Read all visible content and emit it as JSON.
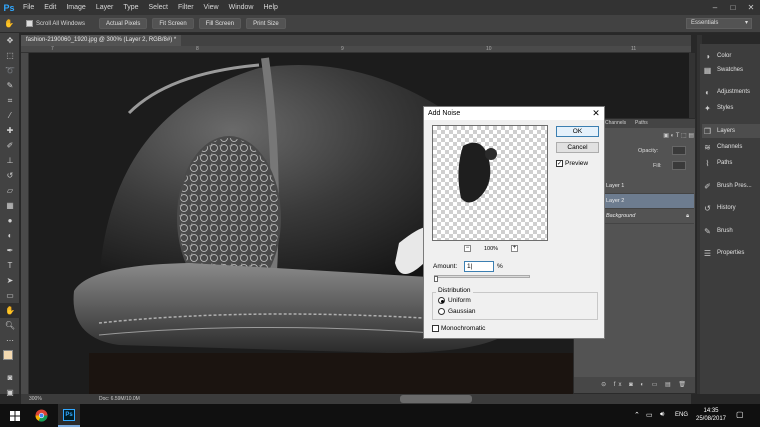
{
  "app": {
    "logo": "Ps",
    "menu": [
      "File",
      "Edit",
      "Image",
      "Layer",
      "Type",
      "Select",
      "Filter",
      "View",
      "Window",
      "Help"
    ],
    "window_controls": [
      "–",
      "□",
      "✕"
    ]
  },
  "options_bar": {
    "scroll_all_windows": "Scroll All Windows",
    "actual_pixels": "Actual Pixels",
    "fit_screen": "Fit Screen",
    "fill_screen": "Fill Screen",
    "print_size": "Print Size",
    "workspace": "Essentials"
  },
  "document": {
    "tab_title": "fashion-2190060_1920.jpg @ 300% (Layer 2, RGB/8#) *",
    "status_zoom": "300%",
    "status_doc": "Doc: 6.59M/10.0M"
  },
  "ruler": {
    "top_ticks": [
      "7",
      "8",
      "9",
      "10",
      "11"
    ]
  },
  "right_panel": {
    "items": [
      {
        "label": "Color",
        "icon": "color-icon"
      },
      {
        "label": "Swatches",
        "icon": "swatches-icon"
      },
      {
        "label": "Adjustments",
        "icon": "adjustments-icon"
      },
      {
        "label": "Styles",
        "icon": "styles-icon"
      },
      {
        "label": "Layers",
        "icon": "layers-icon"
      },
      {
        "label": "Channels",
        "icon": "channels-icon"
      },
      {
        "label": "Paths",
        "icon": "paths-icon"
      },
      {
        "label": "Brush Pres...",
        "icon": "brush-presets-icon"
      },
      {
        "label": "History",
        "icon": "history-icon"
      },
      {
        "label": "Brush",
        "icon": "brush-icon"
      },
      {
        "label": "Properties",
        "icon": "properties-icon"
      }
    ]
  },
  "layers_panel": {
    "tabs": [
      "Channels",
      "Paths"
    ],
    "opacity_label": "Opacity:",
    "fill_label": "Fill:",
    "layers": [
      "Layer 1",
      "Layer 2",
      "Background"
    ]
  },
  "dialog": {
    "title": "Add Noise",
    "ok": "OK",
    "cancel": "Cancel",
    "preview_label": "Preview",
    "preview_checked": true,
    "zoom": "100%",
    "zoom_out": "−",
    "zoom_in": "+",
    "amount_label": "Amount:",
    "amount_value": "1",
    "amount_unit": "%",
    "amount_slider_fraction": 0.01,
    "distribution_label": "Distribution",
    "uniform_label": "Uniform",
    "gaussian_label": "Gaussian",
    "selected_distribution": "Uniform",
    "monochromatic_label": "Monochromatic",
    "monochromatic_checked": false
  },
  "taskbar": {
    "language": "ENG",
    "time": "14:35",
    "date": "25/08/2017"
  },
  "colors": {
    "accent": "#31a8ff",
    "foreground_swatch": "#f3d9b1",
    "background_swatch": "#ffffff"
  }
}
